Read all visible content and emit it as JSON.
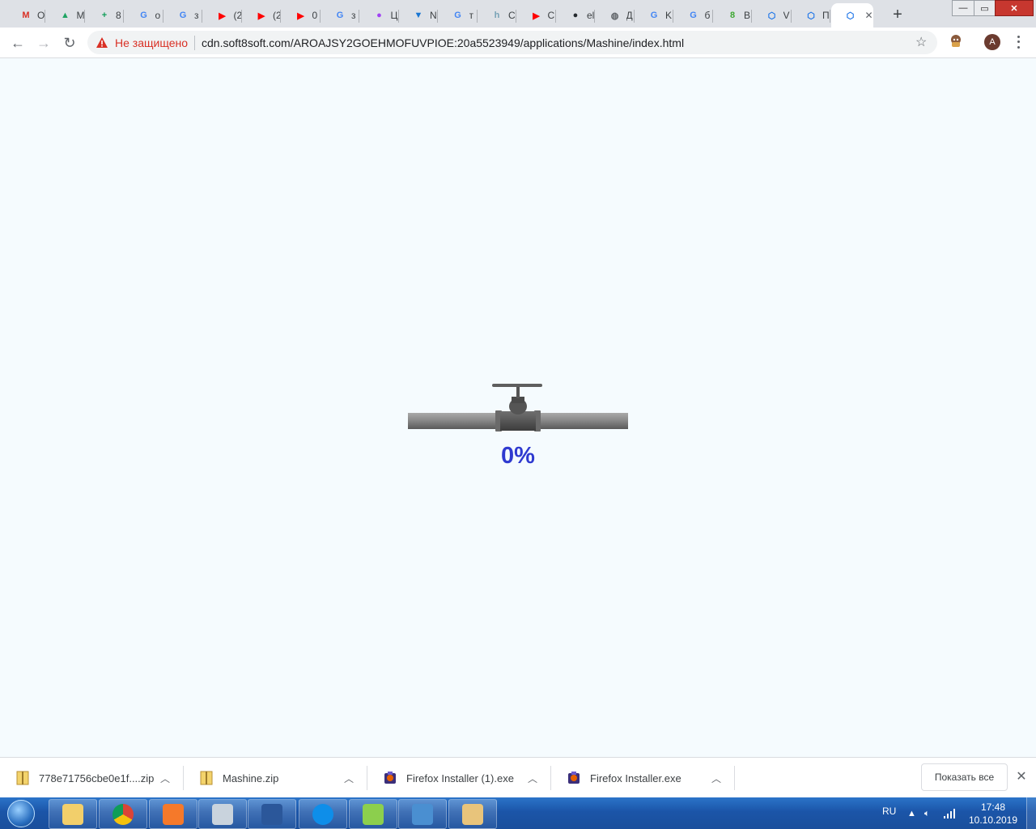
{
  "browser": {
    "tabs": [
      {
        "label": "O",
        "icon": "gmail-icon",
        "glyph": "M",
        "color": "#d93025"
      },
      {
        "label": "M",
        "icon": "google-drive-icon",
        "glyph": "▲",
        "color": "#1fa463"
      },
      {
        "label": "8",
        "icon": "google-sheets-icon",
        "glyph": "+",
        "color": "#0f9d58"
      },
      {
        "label": "о",
        "icon": "google-icon",
        "glyph": "G",
        "color": "#4285f4"
      },
      {
        "label": "з",
        "icon": "google-icon",
        "glyph": "G",
        "color": "#4285f4"
      },
      {
        "label": "(2",
        "icon": "youtube-icon",
        "glyph": "▶",
        "color": "#ff0000"
      },
      {
        "label": "(2",
        "icon": "youtube-icon",
        "glyph": "▶",
        "color": "#ff0000"
      },
      {
        "label": "0",
        "icon": "youtube-icon",
        "glyph": "▶",
        "color": "#ff0000"
      },
      {
        "label": "з",
        "icon": "google-icon",
        "glyph": "G",
        "color": "#4285f4"
      },
      {
        "label": "Ц",
        "icon": "color-wheel-icon",
        "glyph": "●",
        "color": "#a142f4"
      },
      {
        "label": "N",
        "icon": "vuetify-icon",
        "glyph": "▼",
        "color": "#1976d2"
      },
      {
        "label": "т",
        "icon": "google-icon",
        "glyph": "G",
        "color": "#4285f4"
      },
      {
        "label": "C",
        "icon": "habr-icon",
        "glyph": "h",
        "color": "#77a2b6"
      },
      {
        "label": "C",
        "icon": "youtube-icon",
        "glyph": "▶",
        "color": "#ff0000"
      },
      {
        "label": "el",
        "icon": "github-icon",
        "glyph": "●",
        "color": "#24292e"
      },
      {
        "label": "Д",
        "icon": "globe-icon",
        "glyph": "◍",
        "color": "#5f6368"
      },
      {
        "label": "K",
        "icon": "google-icon",
        "glyph": "G",
        "color": "#4285f4"
      },
      {
        "label": "б",
        "icon": "google-icon",
        "glyph": "G",
        "color": "#4285f4"
      },
      {
        "label": "В",
        "icon": "rambler-icon",
        "glyph": "8",
        "color": "#3ea832"
      },
      {
        "label": "V",
        "icon": "soft8soft-icon",
        "glyph": "⬡",
        "color": "#1a73e8"
      },
      {
        "label": "П",
        "icon": "soft8soft-icon",
        "glyph": "⬡",
        "color": "#1a73e8"
      },
      {
        "label": "",
        "icon": "soft8soft-icon",
        "glyph": "⬡",
        "color": "#1a73e8"
      }
    ],
    "new_tab": "+",
    "window_controls": {
      "minimize": "—",
      "maximize": "▭",
      "close": "✕"
    },
    "toolbar": {
      "back": "←",
      "forward": "→",
      "reload": "↻",
      "security_label": "Не защищено",
      "url": "cdn.soft8soft.com/AROAJSY2GOEHMOFUVPIOE:20a5523949/applications/Mashine/index.html",
      "bookmark": "☆",
      "profile_initial": "A"
    }
  },
  "page": {
    "loader_percent": "0%",
    "progress": 0
  },
  "downloads": {
    "items": [
      {
        "name": "778e71756cbe0e1f....zip",
        "icon": "zip-file-icon"
      },
      {
        "name": "Mashine.zip",
        "icon": "zip-file-icon"
      },
      {
        "name": "Firefox Installer (1).exe",
        "icon": "installer-icon"
      },
      {
        "name": "Firefox Installer.exe",
        "icon": "installer-icon"
      }
    ],
    "show_all": "Показать все",
    "close": "✕"
  },
  "taskbar": {
    "apps": [
      {
        "name": "explorer",
        "icon": "folder-icon",
        "color": "#f2cf6b"
      },
      {
        "name": "chrome",
        "icon": "chrome-icon",
        "color": "#db4437"
      },
      {
        "name": "blender",
        "icon": "blender-icon",
        "color": "#f5792a"
      },
      {
        "name": "calculator",
        "icon": "calculator-icon",
        "color": "#c9d3dd"
      },
      {
        "name": "word",
        "icon": "word-icon",
        "color": "#2b579a"
      },
      {
        "name": "teamviewer",
        "icon": "teamviewer-icon",
        "color": "#0e8ee9"
      },
      {
        "name": "notepad++",
        "icon": "notepad-icon",
        "color": "#8ccf4d"
      },
      {
        "name": "photo-viewer",
        "icon": "photo-icon",
        "color": "#4a8fd1"
      },
      {
        "name": "paint",
        "icon": "paint-icon",
        "color": "#e8c47b"
      }
    ],
    "language": "RU",
    "time": "17:48",
    "date": "10.10.2019"
  }
}
